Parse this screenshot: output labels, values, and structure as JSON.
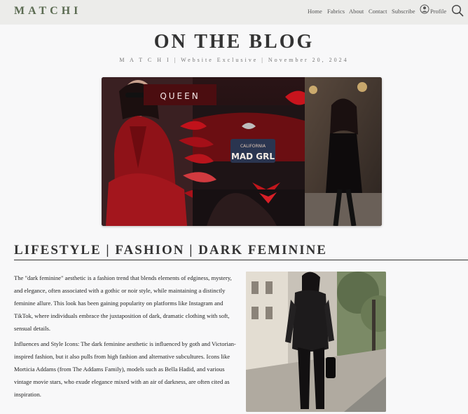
{
  "header": {
    "logo": "MATCHI",
    "nav": [
      "Home",
      "Fabrics",
      "About",
      "Contact",
      "Subscribe"
    ],
    "profile_label": "Profile"
  },
  "blog": {
    "title": "ON THE BLOG",
    "byline": "M A T C H I | Website Exclusive | November 20, 2024"
  },
  "hero": {
    "label_queen": "QUEEN",
    "plate_state": "CALIFORNIA",
    "plate_text": "MAD GRL"
  },
  "article": {
    "heading": "LIFESTYLE | FASHION | DARK FEMININE",
    "paragraphs": [
      "The \"dark feminine\" aesthetic is a fashion trend that blends elements of edginess, mystery, and elegance, often associated with a gothic or noir style, while maintaining a distinctly feminine allure. This look has been gaining popularity on platforms like Instagram and TikTok, where individuals embrace the juxtaposition of dark, dramatic clothing with soft, sensual details.",
      "Influences and Style Icons: The dark feminine aesthetic is influenced by goth and Victorian-inspired fashion, but it also pulls from high fashion and alternative subcultures. Icons like Morticia Addams (from The Addams Family), models such as Bella Hadid, and various vintage movie stars, who exude elegance mixed with an air of darkness, are often cited as inspiration."
    ]
  },
  "colors": {
    "brand": "#5b6b52",
    "topbar_bg": "#ececea",
    "accent_red": "#8b0f16"
  }
}
